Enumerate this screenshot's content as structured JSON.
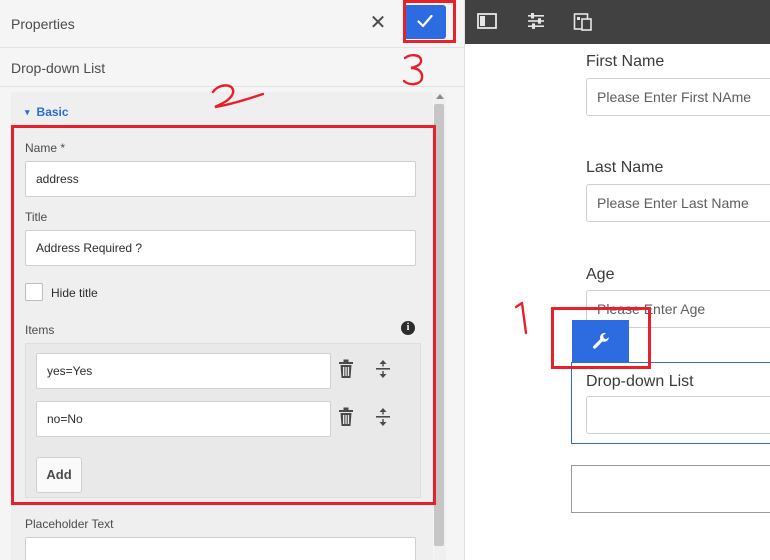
{
  "panel": {
    "title": "Properties",
    "close_label": "✕",
    "component_type": "Drop-down List",
    "section": {
      "label": "Basic",
      "chevron": "chevron-down-icon"
    },
    "name_field": {
      "label": "Name *",
      "value": "address"
    },
    "title_field": {
      "label": "Title",
      "value": "Address Required ?"
    },
    "hide_title": {
      "label": "Hide title",
      "checked": false
    },
    "items": {
      "label": "Items",
      "info_icon": "info-icon",
      "entries": [
        {
          "value": "yes=Yes"
        },
        {
          "value": "no=No"
        }
      ],
      "add_label": "Add"
    },
    "placeholder_field": {
      "label": "Placeholder Text",
      "value": ""
    }
  },
  "toolbar": {
    "icons": [
      "panel-icon",
      "sliders-icon",
      "responsive-icon"
    ]
  },
  "preview": {
    "first_name": {
      "label": "First Name",
      "placeholder": "Please Enter First NAme"
    },
    "last_name": {
      "label": "Last Name",
      "placeholder": "Please Enter Last Name"
    },
    "age": {
      "label": "Age",
      "placeholder": "Please Enter Age"
    },
    "dropdown": {
      "label": "Drop-down List",
      "value": ""
    }
  },
  "annotations": {
    "color": "#e8202a",
    "labels": [
      "1",
      "2",
      "3"
    ]
  },
  "colors": {
    "accent": "#2d6be0",
    "toolbar": "#414141",
    "annotation": "#e8202a"
  }
}
